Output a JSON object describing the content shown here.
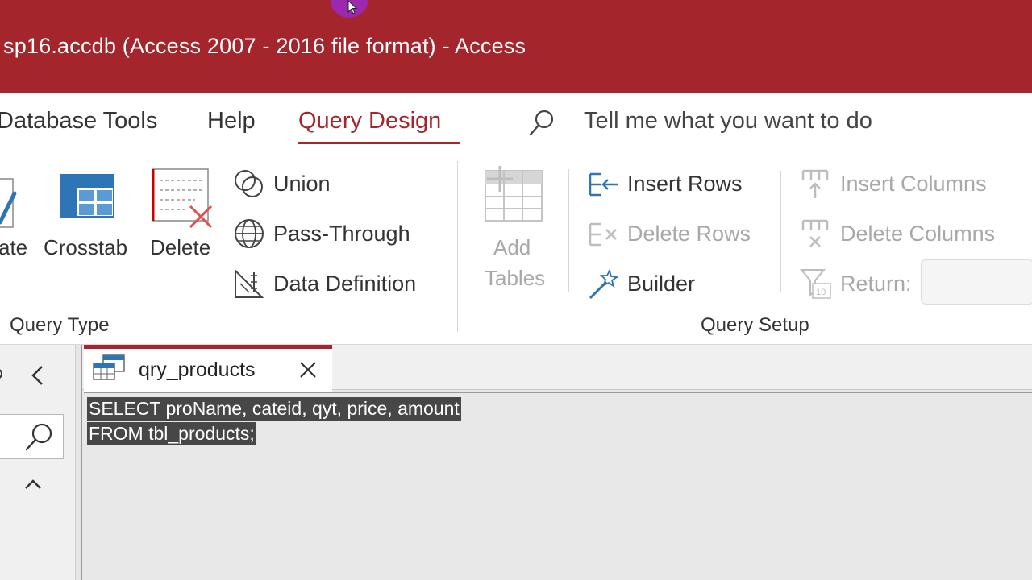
{
  "window": {
    "title": "sp16.accdb (Access 2007 - 2016 file format)  -  Access"
  },
  "menu": {
    "tabs": [
      {
        "label": "Database Tools",
        "active": false
      },
      {
        "label": "Help",
        "active": false
      },
      {
        "label": "Query Design",
        "active": true
      }
    ],
    "tell_me": "Tell me what you want to do"
  },
  "ribbon": {
    "query_type": {
      "partial_label": "ate",
      "crosstab": "Crosstab",
      "delete": "Delete",
      "union": "Union",
      "pass_through": "Pass-Through",
      "data_definition": "Data Definition",
      "group_label": "Query Type"
    },
    "query_setup": {
      "add_tables_line1": "Add",
      "add_tables_line2": "Tables",
      "insert_rows": "Insert Rows",
      "delete_rows": "Delete Rows",
      "builder": "Builder",
      "insert_columns": "Insert Columns",
      "delete_columns": "Delete Columns",
      "return_label": "Return:",
      "return_value": "",
      "group_label": "Query Setup"
    }
  },
  "document": {
    "tab_label": "qry_products",
    "sql_lines": [
      "SELECT proName, cateid, qyt, price, amount",
      "FROM tbl_products;"
    ]
  },
  "colors": {
    "accent": "#a4262c",
    "selection": "#474747"
  }
}
